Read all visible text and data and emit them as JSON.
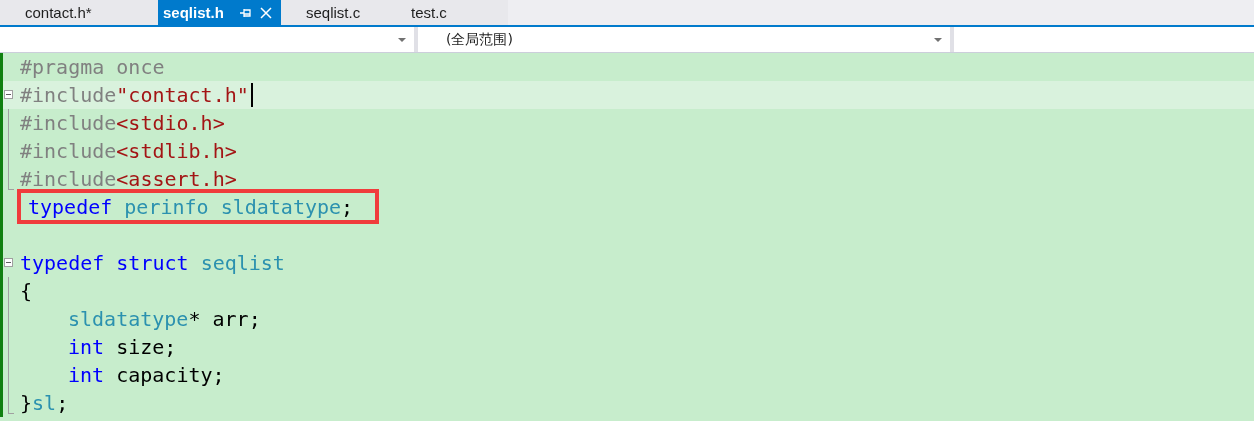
{
  "tabs": [
    {
      "label": "contact.h*",
      "selected": false
    },
    {
      "label": "seqlist.h",
      "selected": true
    },
    {
      "label": "seqlist.c",
      "selected": false
    },
    {
      "label": "test.c",
      "selected": false
    }
  ],
  "navigation_bar": {
    "scope": "(全局范围)"
  },
  "code_lines": [
    {
      "current": false,
      "highlighted": false,
      "tokens": [
        {
          "kind": "preproc",
          "text": "#pragma once"
        }
      ]
    },
    {
      "expanded": true,
      "current": true,
      "highlighted": false,
      "tokens": [
        {
          "kind": "preproc",
          "text": "#include"
        },
        {
          "kind": "string",
          "text": "\"contact.h\""
        }
      ],
      "children": [
        {
          "current": false,
          "highlighted": false,
          "tokens": [
            {
              "kind": "preproc",
              "text": "#include"
            },
            {
              "kind": "string",
              "text": "<stdio.h>"
            }
          ]
        },
        {
          "current": false,
          "highlighted": false,
          "tokens": [
            {
              "kind": "preproc",
              "text": "#include"
            },
            {
              "kind": "string",
              "text": "<stdlib.h>"
            }
          ]
        },
        {
          "current": false,
          "highlighted": false,
          "tokens": [
            {
              "kind": "preproc",
              "text": "#include"
            },
            {
              "kind": "string",
              "text": "<assert.h>"
            }
          ]
        }
      ]
    },
    {
      "current": false,
      "highlighted": true,
      "tokens": [
        {
          "kind": "keyword",
          "text": "typedef "
        },
        {
          "kind": "type",
          "text": "perinfo "
        },
        {
          "kind": "type",
          "text": "sldatatype"
        },
        {
          "kind": "plain",
          "text": ";"
        }
      ]
    },
    {
      "current": false,
      "highlighted": false
    },
    {
      "expanded": true,
      "current": false,
      "highlighted": false,
      "tokens": [
        {
          "kind": "keyword",
          "text": "typedef "
        },
        {
          "kind": "keyword",
          "text": "struct "
        },
        {
          "kind": "type",
          "text": "seqlist"
        }
      ],
      "children": [
        {
          "current": false,
          "highlighted": false,
          "tokens": [
            {
              "kind": "plain",
              "text": "{"
            }
          ],
          "children": [
            {
              "current": false,
              "highlighted": false,
              "tokens": [
                {
                  "kind": "type",
                  "text": "sldatatype"
                },
                {
                  "kind": "plain",
                  "text": "* arr;"
                }
              ]
            },
            {
              "current": false,
              "highlighted": false,
              "tokens": [
                {
                  "kind": "keyword",
                  "text": "int "
                },
                {
                  "kind": "plain",
                  "text": "size;"
                }
              ]
            },
            {
              "current": false,
              "highlighted": false,
              "tokens": [
                {
                  "kind": "keyword",
                  "text": "int "
                },
                {
                  "kind": "plain",
                  "text": "capacity;"
                }
              ]
            }
          ]
        },
        {
          "current": false,
          "highlighted": false,
          "tokens": [
            {
              "kind": "plain",
              "text": "}"
            },
            {
              "kind": "type",
              "text": "sl"
            },
            {
              "kind": "plain",
              "text": ";"
            }
          ]
        }
      ]
    }
  ]
}
